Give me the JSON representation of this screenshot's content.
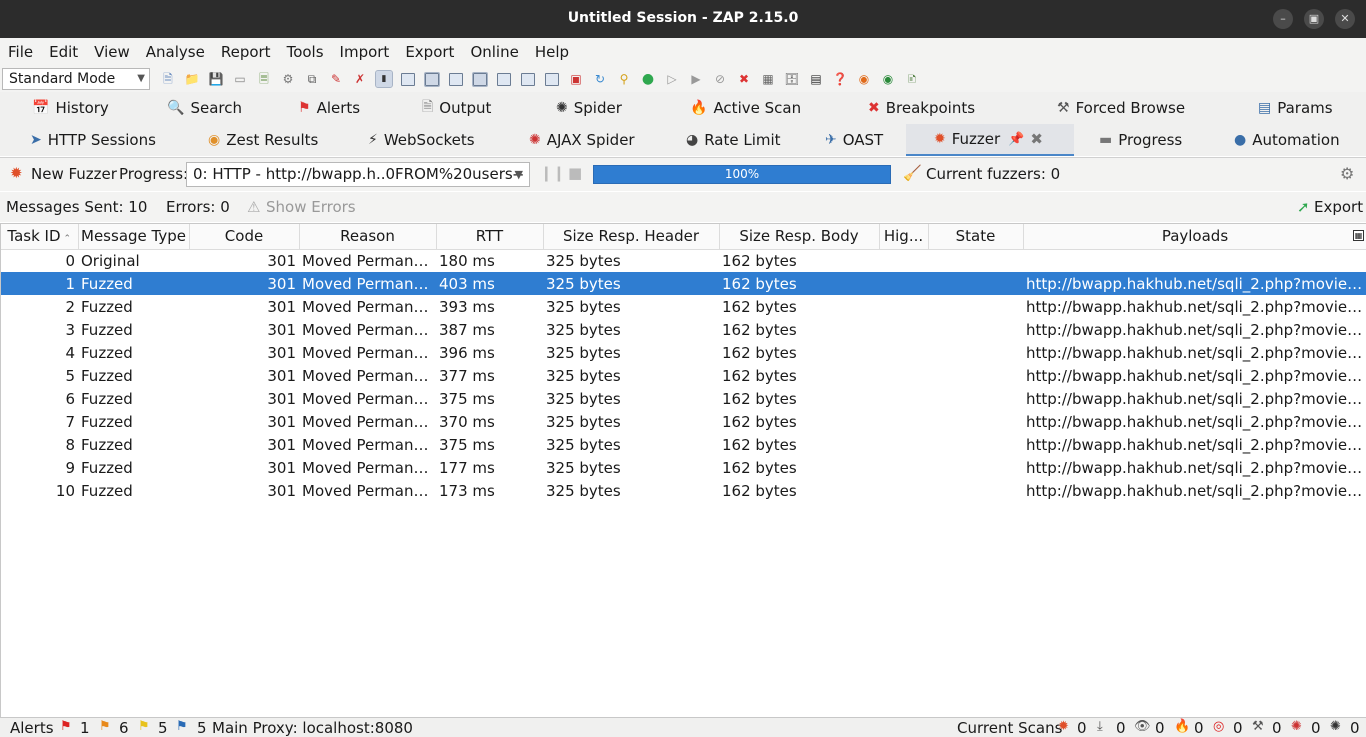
{
  "window": {
    "title": "Untitled Session - ZAP 2.15.0"
  },
  "menu": [
    "File",
    "Edit",
    "View",
    "Analyse",
    "Report",
    "Tools",
    "Import",
    "Export",
    "Online",
    "Help"
  ],
  "toolbar": {
    "mode": "Standard Mode"
  },
  "tabs_row1": [
    {
      "label": "History",
      "icon": "history-icon"
    },
    {
      "label": "Search",
      "icon": "search-icon"
    },
    {
      "label": "Alerts",
      "icon": "flag-icon"
    },
    {
      "label": "Output",
      "icon": "document-icon"
    },
    {
      "label": "Spider",
      "icon": "spider-icon"
    },
    {
      "label": "Active Scan",
      "icon": "flame-icon"
    },
    {
      "label": "Breakpoints",
      "icon": "cross-icon"
    },
    {
      "label": "Forced Browse",
      "icon": "hammer-icon"
    },
    {
      "label": "Params",
      "icon": "params-icon"
    }
  ],
  "tabs_row2": [
    {
      "label": "HTTP Sessions",
      "icon": "sessions-icon"
    },
    {
      "label": "Zest Results",
      "icon": "zest-icon"
    },
    {
      "label": "WebSockets",
      "icon": "plug-icon"
    },
    {
      "label": "AJAX Spider",
      "icon": "spider-red-icon"
    },
    {
      "label": "Rate Limit",
      "icon": "speedometer-icon"
    },
    {
      "label": "OAST",
      "icon": "oast-icon"
    },
    {
      "label": "Fuzzer",
      "icon": "fuzzer-icon"
    },
    {
      "label": "Progress",
      "icon": "progress-icon"
    },
    {
      "label": "Automation",
      "icon": "robot-icon"
    }
  ],
  "fuzzer": {
    "new_fuzzer": "New Fuzzer",
    "progress_label": "Progress:",
    "progress_selected": "0: HTTP - http://bwapp.h..0FROM%20users--",
    "progress_percent": "100%",
    "progress_value": 1.0,
    "current_fuzzers": "Current fuzzers: 0",
    "messages_sent": "Messages Sent: 10",
    "errors": "Errors: 0",
    "show_errors": "Show Errors",
    "export": "Export"
  },
  "table": {
    "columns": [
      "Task ID",
      "Message Type",
      "Code",
      "Reason",
      "RTT",
      "Size Resp. Header",
      "Size Resp. Body",
      "Hig...",
      "State",
      "Payloads"
    ],
    "rows": [
      {
        "id": "0",
        "type": "Original",
        "code": "301",
        "reason": "Moved Permane...",
        "rtt": "180 ms",
        "hdr": "325 bytes",
        "body": "162 bytes",
        "hig": "",
        "state": "",
        "payloads": ""
      },
      {
        "id": "1",
        "type": "Fuzzed",
        "code": "301",
        "reason": "Moved Permane...",
        "rtt": "403 ms",
        "hdr": "325 bytes",
        "body": "162 bytes",
        "hig": "",
        "state": "",
        "payloads": "http://bwapp.hakhub.net/sqli_2.php?movie=..."
      },
      {
        "id": "2",
        "type": "Fuzzed",
        "code": "301",
        "reason": "Moved Permane...",
        "rtt": "393 ms",
        "hdr": "325 bytes",
        "body": "162 bytes",
        "hig": "",
        "state": "",
        "payloads": "http://bwapp.hakhub.net/sqli_2.php?movie=..."
      },
      {
        "id": "3",
        "type": "Fuzzed",
        "code": "301",
        "reason": "Moved Permane...",
        "rtt": "387 ms",
        "hdr": "325 bytes",
        "body": "162 bytes",
        "hig": "",
        "state": "",
        "payloads": "http://bwapp.hakhub.net/sqli_2.php?movie=..."
      },
      {
        "id": "4",
        "type": "Fuzzed",
        "code": "301",
        "reason": "Moved Permane...",
        "rtt": "396 ms",
        "hdr": "325 bytes",
        "body": "162 bytes",
        "hig": "",
        "state": "",
        "payloads": "http://bwapp.hakhub.net/sqli_2.php?movie=..."
      },
      {
        "id": "5",
        "type": "Fuzzed",
        "code": "301",
        "reason": "Moved Permane...",
        "rtt": "377 ms",
        "hdr": "325 bytes",
        "body": "162 bytes",
        "hig": "",
        "state": "",
        "payloads": "http://bwapp.hakhub.net/sqli_2.php?movie=..."
      },
      {
        "id": "6",
        "type": "Fuzzed",
        "code": "301",
        "reason": "Moved Permane...",
        "rtt": "375 ms",
        "hdr": "325 bytes",
        "body": "162 bytes",
        "hig": "",
        "state": "",
        "payloads": "http://bwapp.hakhub.net/sqli_2.php?movie=..."
      },
      {
        "id": "7",
        "type": "Fuzzed",
        "code": "301",
        "reason": "Moved Permane...",
        "rtt": "370 ms",
        "hdr": "325 bytes",
        "body": "162 bytes",
        "hig": "",
        "state": "",
        "payloads": "http://bwapp.hakhub.net/sqli_2.php?movie=..."
      },
      {
        "id": "8",
        "type": "Fuzzed",
        "code": "301",
        "reason": "Moved Permane...",
        "rtt": "375 ms",
        "hdr": "325 bytes",
        "body": "162 bytes",
        "hig": "",
        "state": "",
        "payloads": "http://bwapp.hakhub.net/sqli_2.php?movie=..."
      },
      {
        "id": "9",
        "type": "Fuzzed",
        "code": "301",
        "reason": "Moved Permane...",
        "rtt": "177 ms",
        "hdr": "325 bytes",
        "body": "162 bytes",
        "hig": "",
        "state": "",
        "payloads": "http://bwapp.hakhub.net/sqli_2.php?movie=..."
      },
      {
        "id": "10",
        "type": "Fuzzed",
        "code": "301",
        "reason": "Moved Permane...",
        "rtt": "173 ms",
        "hdr": "325 bytes",
        "body": "162 bytes",
        "hig": "",
        "state": "",
        "payloads": "http://bwapp.hakhub.net/sqli_2.php?movie=..."
      }
    ],
    "selected_row": 1
  },
  "status": {
    "alerts_label": "Alerts",
    "alert_counts": [
      "1",
      "6",
      "5",
      "5"
    ],
    "proxy": "Main Proxy: localhost:8080",
    "current_scans_label": "Current Scans",
    "scan_counts": [
      "0",
      "0",
      "0",
      "0",
      "0",
      "0",
      "0",
      "0"
    ]
  },
  "colors": {
    "selection": "#2f7dd1",
    "titlebar": "#2c2c2c",
    "progress": "#2f7dd1"
  }
}
